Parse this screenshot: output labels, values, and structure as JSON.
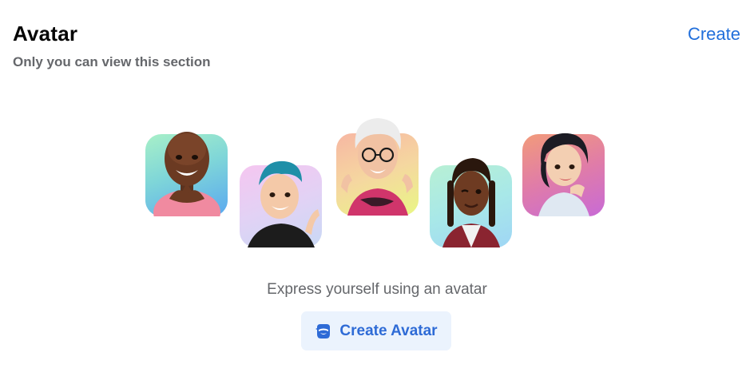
{
  "section": {
    "title": "Avatar",
    "subtitle": "Only you can view this section",
    "create_link_label": "Create"
  },
  "avatars": [
    {
      "icon": "avatar-bald-man-icon",
      "gradient": [
        "#a8f0c8",
        "#5aa8f0"
      ]
    },
    {
      "icon": "avatar-blue-hair-man-icon",
      "gradient": [
        "#f5c6f0",
        "#c9d9f5"
      ]
    },
    {
      "icon": "avatar-white-hair-woman-icon",
      "gradient": [
        "#f7b7a3",
        "#e9f784"
      ]
    },
    {
      "icon": "avatar-braids-woman-icon",
      "gradient": [
        "#b8f0d4",
        "#9fd6f5"
      ]
    },
    {
      "icon": "avatar-black-hair-woman-icon",
      "gradient": [
        "#f29b7a",
        "#c86ad6"
      ]
    }
  ],
  "main": {
    "tagline": "Express yourself using an avatar",
    "cta_label": "Create Avatar",
    "cta_icon": "avatar-face-icon"
  },
  "colors": {
    "accent": "#216fdb",
    "button_bg": "#ebf3fd",
    "secondary_text": "#65676b"
  }
}
